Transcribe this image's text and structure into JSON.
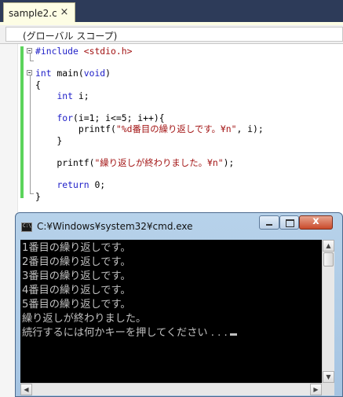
{
  "ide": {
    "tab": {
      "label": "sample2.c",
      "close_glyph": "×"
    },
    "scope": {
      "label": "(グローバル スコープ)"
    },
    "code": [
      [
        {
          "t": "#include ",
          "c": "pp"
        },
        {
          "t": "<stdio.h>",
          "c": "inc"
        }
      ],
      [],
      [
        {
          "t": "int",
          "c": "kw"
        },
        {
          "t": " main(",
          "c": "pl"
        },
        {
          "t": "void",
          "c": "kw"
        },
        {
          "t": ")",
          "c": "pl"
        }
      ],
      [
        {
          "t": "{",
          "c": "pl"
        }
      ],
      [
        {
          "t": "    ",
          "c": "pl"
        },
        {
          "t": "int",
          "c": "kw"
        },
        {
          "t": " i;",
          "c": "pl"
        }
      ],
      [],
      [
        {
          "t": "    ",
          "c": "pl"
        },
        {
          "t": "for",
          "c": "kw"
        },
        {
          "t": "(i=1; i<=5; i++){",
          "c": "pl"
        }
      ],
      [
        {
          "t": "        printf(",
          "c": "pl"
        },
        {
          "t": "\"%d番目の繰り返しです。¥n\"",
          "c": "str"
        },
        {
          "t": ", i);",
          "c": "pl"
        }
      ],
      [
        {
          "t": "    }",
          "c": "pl"
        }
      ],
      [],
      [
        {
          "t": "    printf(",
          "c": "pl"
        },
        {
          "t": "\"繰り返しが終わりました。¥n\"",
          "c": "str"
        },
        {
          "t": ");",
          "c": "pl"
        }
      ],
      [],
      [
        {
          "t": "    ",
          "c": "pl"
        },
        {
          "t": "return",
          "c": "kw"
        },
        {
          "t": " 0;",
          "c": "pl"
        }
      ],
      [
        {
          "t": "}",
          "c": "pl"
        }
      ]
    ]
  },
  "cmd": {
    "title": "C:¥Windows¥system32¥cmd.exe",
    "lines": [
      "1番目の繰り返しです。",
      "2番目の繰り返しです。",
      "3番目の繰り返しです。",
      "4番目の繰り返しです。",
      "5番目の繰り返しです。",
      "繰り返しが終わりました。",
      "続行するには何かキーを押してください . . ."
    ]
  }
}
